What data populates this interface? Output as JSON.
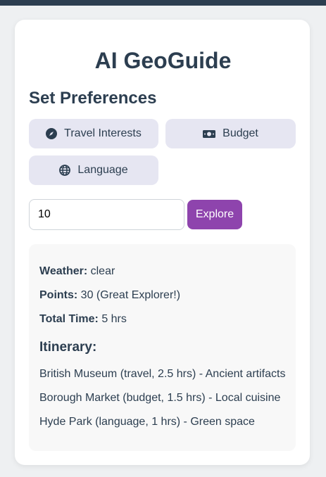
{
  "app": {
    "title": "AI GeoGuide"
  },
  "preferences": {
    "heading": "Set Preferences",
    "buttons": [
      {
        "label": "Travel Interests",
        "icon": "compass-icon"
      },
      {
        "label": "Budget",
        "icon": "money-bill-icon"
      },
      {
        "label": "Language",
        "icon": "globe-icon"
      }
    ]
  },
  "search": {
    "value": "10",
    "explore_label": "Explore"
  },
  "results": {
    "weather_label": "Weather:",
    "weather_value": "clear",
    "points_label": "Points:",
    "points_value": "30 (Great Explorer!)",
    "time_label": "Total Time:",
    "time_value": "5 hrs",
    "itinerary_heading": "Itinerary:",
    "itinerary": [
      "British Museum (travel, 2.5 hrs) - Ancient artifacts",
      "Borough Market (budget, 1.5 hrs) - Local cuisine",
      "Hyde Park (language, 1 hrs) - Green space"
    ]
  },
  "colors": {
    "primary_text": "#2c3e50",
    "accent": "#8e44ad",
    "button_bg": "#e6e6f2"
  }
}
